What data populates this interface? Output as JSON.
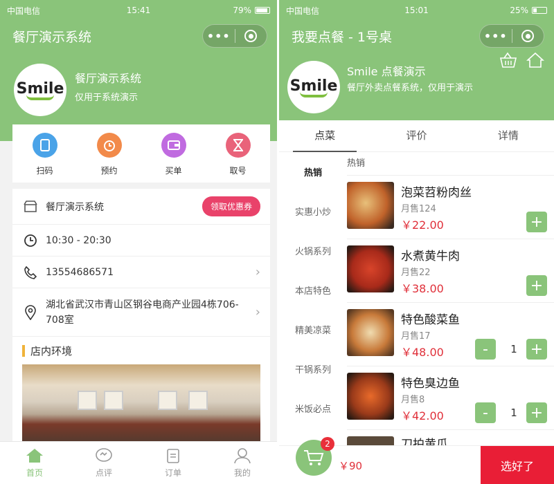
{
  "left": {
    "status": {
      "carrier": "中国电信",
      "time": "15:41",
      "battery": "79%",
      "battery_level": 0.79
    },
    "nav_title": "餐厅演示系统",
    "capsule_dots": "•••",
    "logo_text": "Smile",
    "shop_name": "餐厅演示系统",
    "shop_desc": "仅用于系统演示",
    "quick_actions": [
      {
        "label": "扫码",
        "icon": "scan-icon",
        "color": "#4aa3e8"
      },
      {
        "label": "预约",
        "icon": "alarm-clock-icon",
        "color": "#f28a4a"
      },
      {
        "label": "买单",
        "icon": "wallet-icon",
        "color": "#c06be0"
      },
      {
        "label": "取号",
        "icon": "hourglass-icon",
        "color": "#e9637a"
      }
    ],
    "info": {
      "shop_name": "餐厅演示系统",
      "coupon": "领取优惠券",
      "hours": "10:30 - 20:30",
      "phone": "13554686571",
      "address": "湖北省武汉市青山区钢谷电商产业园4栋706-708室"
    },
    "env_title": "店内环境",
    "tabs": [
      {
        "label": "首页",
        "icon": "home-icon",
        "active": true
      },
      {
        "label": "点评",
        "icon": "comment-icon",
        "active": false
      },
      {
        "label": "订单",
        "icon": "order-icon",
        "active": false
      },
      {
        "label": "我的",
        "icon": "user-icon",
        "active": false
      }
    ]
  },
  "right": {
    "status": {
      "carrier": "中国电信",
      "time": "15:01",
      "battery": "25%",
      "battery_level": 0.25
    },
    "nav_title": "我要点餐 - 1号桌",
    "capsule_dots": "•••",
    "logo_text": "Smile",
    "shop_name": "Smile 点餐演示",
    "shop_desc": "餐厅外卖点餐系统，仅用于演示",
    "tabs": [
      "点菜",
      "评价",
      "详情"
    ],
    "categories": [
      "热销",
      "实惠小炒",
      "火锅系列",
      "本店特色",
      "精美凉菜",
      "干锅系列",
      "米饭必点"
    ],
    "section_title": "热销",
    "dishes": [
      {
        "name": "泡菜苕粉肉丝",
        "sales": "月售124",
        "price": "￥22.00",
        "qty": ""
      },
      {
        "name": "水煮黄牛肉",
        "sales": "月售22",
        "price": "￥38.00",
        "qty": ""
      },
      {
        "name": "特色酸菜鱼",
        "sales": "月售17",
        "price": "￥48.00",
        "qty": "1"
      },
      {
        "name": "特色臭边鱼",
        "sales": "月售8",
        "price": "￥42.00",
        "qty": "1"
      },
      {
        "name": "刀拍黄瓜",
        "sales": "",
        "price": "",
        "qty": ""
      }
    ],
    "cart_count": "2",
    "total": "￥90",
    "done_label": "选好了"
  }
}
